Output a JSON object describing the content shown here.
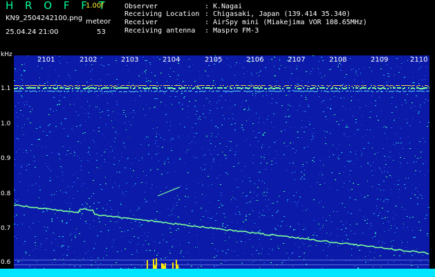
{
  "header": {
    "app_title": "H R O F F T",
    "version": "1.00f",
    "filename": "KN9_2504242100.png",
    "meteor_label": "meteor",
    "datetime": "25.04.24 21:00",
    "meteor_count": "53"
  },
  "info": [
    {
      "key": "Observer",
      "colon": ":",
      "value": "K.Nagai"
    },
    {
      "key": "Receiving Location",
      "colon": ":",
      "value": "Chigasaki, Japan (139.414 35.340)"
    },
    {
      "key": "Receiver",
      "colon": ":",
      "value": "AirSpy mini (Miakejima VOR 108.65MHz)"
    },
    {
      "key": "Receiving antenna",
      "colon": ":",
      "value": "Maspro FM-3"
    }
  ],
  "axes": {
    "y_unit": "kHz",
    "y_ticks": [
      "1.1",
      "1.0",
      "0.9",
      "0.8",
      "0.7",
      "0.6"
    ],
    "x_ticks": [
      "2101",
      "2102",
      "2103",
      "2104",
      "2105",
      "2106",
      "2107",
      "2108",
      "2109",
      "2110"
    ]
  },
  "colors": {
    "title": "#00ff99",
    "version": "#ffee33",
    "background": "#0b1aa8",
    "bottom_bar": "#00e5ff",
    "trace": "#7cff9a"
  }
}
